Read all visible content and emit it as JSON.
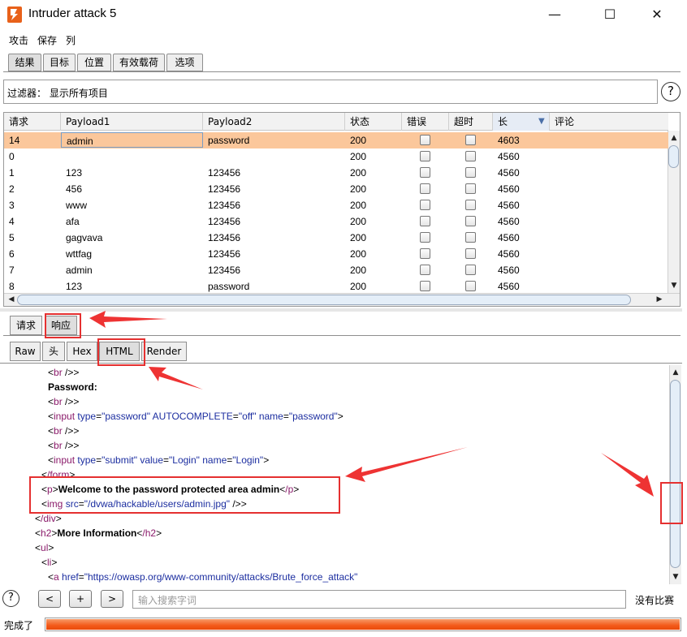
{
  "window": {
    "title": "Intruder attack 5",
    "minimize": "—",
    "maximize": "☐",
    "close": "✕"
  },
  "menu": [
    "攻击",
    "保存",
    "列"
  ],
  "tabs": [
    "结果",
    "目标",
    "位置",
    "有效载荷",
    "选项"
  ],
  "filter": {
    "label": "过滤器：",
    "value": "显示所有项目"
  },
  "help_icon": "?",
  "table": {
    "columns": [
      "请求",
      "Payload1",
      "Payload2",
      "状态",
      "错误",
      "超时",
      "长",
      "评论"
    ],
    "sort_indicator": "▼",
    "rows": [
      {
        "req": "14",
        "p1": "admin",
        "p2": "password",
        "status": "200",
        "len": "4603"
      },
      {
        "req": "0",
        "p1": "",
        "p2": "",
        "status": "200",
        "len": "4560"
      },
      {
        "req": "1",
        "p1": "123",
        "p2": "123456",
        "status": "200",
        "len": "4560"
      },
      {
        "req": "2",
        "p1": "456",
        "p2": "123456",
        "status": "200",
        "len": "4560"
      },
      {
        "req": "3",
        "p1": "www",
        "p2": "123456",
        "status": "200",
        "len": "4560"
      },
      {
        "req": "4",
        "p1": "afa",
        "p2": "123456",
        "status": "200",
        "len": "4560"
      },
      {
        "req": "5",
        "p1": "gagvava",
        "p2": "123456",
        "status": "200",
        "len": "4560"
      },
      {
        "req": "6",
        "p1": "wttfag",
        "p2": "123456",
        "status": "200",
        "len": "4560"
      },
      {
        "req": "7",
        "p1": "admin",
        "p2": "123456",
        "status": "200",
        "len": "4560"
      },
      {
        "req": "8",
        "p1": "123",
        "p2": "password",
        "status": "200",
        "len": "4560"
      }
    ]
  },
  "req_resp_tabs": [
    "请求",
    "响应"
  ],
  "view_tabs": [
    "Raw",
    "头",
    "Hex",
    "HTML",
    "Render"
  ],
  "code": {
    "br": "br",
    "password_label": "Password:",
    "input": "input",
    "type_attr": "type",
    "autocomplete_attr": "AUTOCOMPLETE",
    "name_attr": "name",
    "value_attr": "value",
    "password_val": "\"password\"",
    "off_val": "\"off\"",
    "submit_val": "\"submit\"",
    "login_val": "\"Login\"",
    "form_close": "/form",
    "p": "p",
    "p_close": "/p",
    "welcome": "Welcome to the password protected area admin",
    "img": "img",
    "src_attr": "src",
    "img_src": "\"/dvwa/hackable/users/admin.jpg\"",
    "self_close": " />",
    "div_close": "/div",
    "h2": "h2",
    "h2_close": "/h2",
    "more_info": "More Information",
    "ul": "ul",
    "li": "li",
    "a": "a",
    "href_attr": "href",
    "href_val": "\"https://owasp.org/www-community/attacks/Brute_force_attack\""
  },
  "search": {
    "prev": "<",
    "add": "+",
    "next": ">",
    "placeholder": "输入搜索字词",
    "match_status": "没有比赛"
  },
  "status": {
    "text": "完成了",
    "progress": 1.0
  },
  "colors": {
    "selected_row": "#fbc79b",
    "annotation": "#e53030",
    "progress": "#f35a1a"
  }
}
